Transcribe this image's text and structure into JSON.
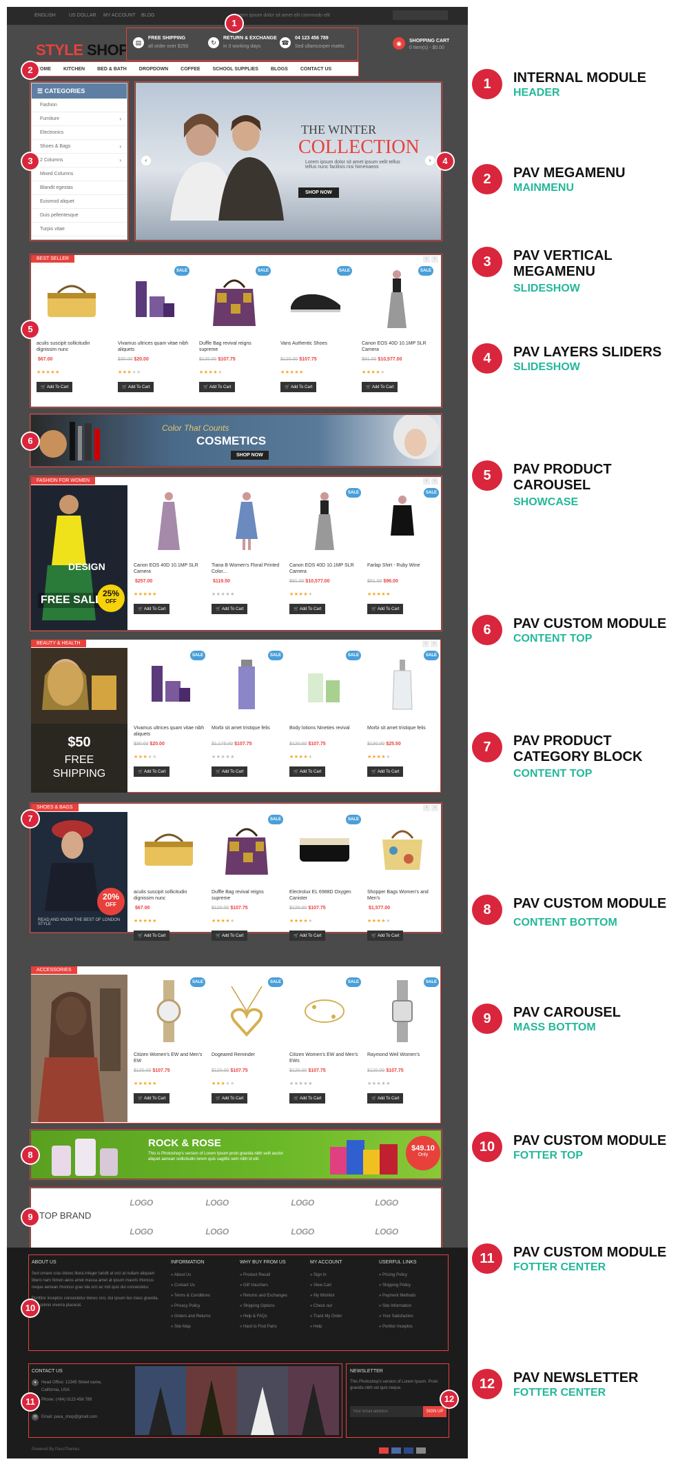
{
  "topbar": {
    "items": [
      "ENGLISH",
      "US DOLLAR",
      "MY ACCOUNT",
      "BLOG"
    ],
    "notice": "Lorem ipsum dolor sit amet elit commodo elit"
  },
  "header": {
    "logo_part1": "STYLE",
    "logo_part2": "SHOP",
    "info": [
      {
        "title": "FREE SHIPPING",
        "sub": "all order over $250",
        "icon": "truck-icon"
      },
      {
        "title": "RETURN & EXCHANGE",
        "sub": "in 3 working days",
        "icon": "refresh-icon"
      },
      {
        "title": "04 123 456 789",
        "sub": "Sed ullamcorper mattis",
        "icon": "phone-icon"
      }
    ],
    "cart_title": "SHOPPING CART",
    "cart_sub": "0 item(s) - $0.00"
  },
  "nav": [
    "HOME",
    "KITCHEN",
    "BED & BATH",
    "DROPDOWN",
    "COFFEE",
    "SCHOOL SUPPLIES",
    "BLOGS",
    "CONTACT US"
  ],
  "vmenu": {
    "title": "CATEGORIES",
    "items": [
      "Fashion",
      "Furniture",
      "Electronics",
      "Shoes & Bags",
      "2 Columns",
      "Mixed Columns",
      "Blandit egestas",
      "Euismod aliquet",
      "Duis pellentesque",
      "Turpis vitae"
    ]
  },
  "slider": {
    "title1": "THE WINTER",
    "title2": "COLLECTION",
    "sub": "Lorem ipsum dolor sit amet ipsum velit tellus tellus nunc facilisis nisi himenaeos",
    "button": "SHOP NOW"
  },
  "bestseller": {
    "tag": "BEST SELLER",
    "products": [
      {
        "name": "aculis suscipit sollicitudin dignissim nunc",
        "old": "",
        "price": "$67.00",
        "rating": 5,
        "sale": false
      },
      {
        "name": "Vivamus ultrices quam vitae nibh aliquets",
        "old": "$30.00",
        "price": "$20.00",
        "rating": 3,
        "sale": true
      },
      {
        "name": "Duffle Bag revival reigns supreme",
        "old": "$120.00",
        "price": "$107.75",
        "rating": 4,
        "sale": true
      },
      {
        "name": "Vans Authentic Shoes",
        "old": "$120.00",
        "price": "$107.75",
        "rating": 5,
        "sale": true
      },
      {
        "name": "Canon EOS 40D 10.1MP SLR Camera",
        "old": "$91.00",
        "price": "$10,577.00",
        "rating": 4,
        "sale": true
      }
    ],
    "button": "Add To Cart"
  },
  "cosmetics": {
    "line1": "Color That Counts",
    "line2": "COSMETICS",
    "button": "SHOP NOW"
  },
  "fashion": {
    "tag": "FASHION FOR WOMEN",
    "promo": {
      "line1": "DESIGN",
      "line2": "FREE SALE",
      "pct": "25%",
      "off": "OFF"
    },
    "products": [
      {
        "name": "Canon EOS 40D 10.1MP SLR Camera",
        "old": "",
        "price": "$257.00",
        "rating": 5,
        "sale": false
      },
      {
        "name": "Tiana B Women's Floral Printed Color...",
        "old": "",
        "price": "$119.50",
        "rating": 0,
        "sale": false
      },
      {
        "name": "Canon EOS 40D 10.1MP SLR Camera",
        "old": "$91.00",
        "price": "$10,577.00",
        "rating": 4,
        "sale": true
      },
      {
        "name": "Farlap Shirt - Ruby Wine",
        "old": "$51.00",
        "price": "$96.00",
        "rating": 5,
        "sale": true
      }
    ]
  },
  "beauty": {
    "tag": "BEAUTY & HEALTH",
    "promo": {
      "price": "$50",
      "line1": "FREE",
      "line2": "SHIPPING"
    },
    "products": [
      {
        "name": "Vivamus ultrices quam vitae nibh aliquets",
        "old": "$30.00",
        "price": "$20.00",
        "rating": 3,
        "sale": true
      },
      {
        "name": "Morbi sit amet tristique felis",
        "old": "$1,175.00",
        "price": "$107.75",
        "rating": 0,
        "sale": true
      },
      {
        "name": "Body lotions Nineties revival",
        "old": "$120.00",
        "price": "$107.75",
        "rating": 4,
        "sale": true
      },
      {
        "name": "Morbi sit amet tristique felis",
        "old": "$130.00",
        "price": "$25.50",
        "rating": 4,
        "sale": true
      }
    ]
  },
  "shoes": {
    "tag": "SHOES & BAGS",
    "promo": {
      "pct": "20%",
      "off": "OFF",
      "line": "READ AND KNOW THE BEST OF LONDON STYLE"
    },
    "products": [
      {
        "name": "aculis suscipit sollicitudin dignissim nunc",
        "old": "",
        "price": "$67.00",
        "rating": 5,
        "sale": false
      },
      {
        "name": "Duffle Bag revival reigns supreme",
        "old": "$120.00",
        "price": "$107.75",
        "rating": 4,
        "sale": true
      },
      {
        "name": "Electrolux EL 6988D Oxygen Canister",
        "old": "$120.00",
        "price": "$107.75",
        "rating": 4,
        "sale": true
      },
      {
        "name": "Shopper Bags Women's and Men's",
        "old": "",
        "price": "$1,577.00",
        "rating": 4,
        "sale": false
      }
    ]
  },
  "accessories": {
    "tag": "ACCESSORIES",
    "products": [
      {
        "name": "Citizen Women's EW and Men's EW",
        "old": "$120.00",
        "price": "$107.75",
        "rating": 5,
        "sale": true
      },
      {
        "name": "Dogeared Reminder",
        "old": "$120.00",
        "price": "$107.75",
        "rating": 3,
        "sale": true
      },
      {
        "name": "Citizen Women's EW and Men's EWs",
        "old": "$120.00",
        "price": "$107.75",
        "rating": 0,
        "sale": true
      },
      {
        "name": "Raymond Weil Women's",
        "old": "$120.00",
        "price": "$107.75",
        "rating": 0,
        "sale": true
      }
    ]
  },
  "rock": {
    "title": "ROCK & ROSE",
    "text": "This is Photoshop's version of Lorem Ipsum proin gravida nibh velit auctor aliquet aenean sollicitudin lorem quis sagittis sem nibh id elit.",
    "price": "$49.10",
    "only": "Only"
  },
  "brands": {
    "title": "TOP BRAND",
    "logo_text": "LOGO"
  },
  "footer": {
    "about_title": "ABOUT US",
    "about_text": "Sed ornare cras donec litora integer taridit at orci at nullam aliquam libero nam himen aeos amet massa amet at ipsum mauris rhoncus neque aenean rhoncus grav ida orci ac nisl quis dui consectetur.",
    "about_text2": "Porttitor inceptos consectetur donec orci, dui ipsum leo class gravida, felis primis viverra placerat.",
    "cols": [
      {
        "title": "INFORMATION",
        "items": [
          "About Us",
          "Contact Us",
          "Terms & Conditions",
          "Privacy Policy",
          "Orders and Returns",
          "Site Map"
        ]
      },
      {
        "title": "WHY BUY FROM US",
        "items": [
          "Product Recall",
          "Gift Vouchers",
          "Returns and Exchanges",
          "Shipping Options",
          "Help & FAQs",
          "Hard to Find Parts"
        ]
      },
      {
        "title": "MY ACCOUNT",
        "items": [
          "Sign In",
          "View Cart",
          "My Wishlist",
          "Check out",
          "Track My Order",
          "Help"
        ]
      },
      {
        "title": "USERFUL LINKS",
        "items": [
          "Pricing Policy",
          "Shipping Policy",
          "Payment Methods",
          "Site Information",
          "Your Satisfaction",
          "Portitor Inceptos"
        ]
      }
    ],
    "contact_title": "CONTACT US",
    "address1": "Head Office: 12345 Street name,",
    "address2": "California, USA",
    "phone": "Phone: (+84) 0123 456 789",
    "email": "Email: pava_shop@gmail.com",
    "newsletter_title": "NEWSLETTER",
    "newsletter_text": "This Photoshop's version of Lorem Ipsum. Proin gravida nibh vel quis neque.",
    "newsletter_placeholder": "Your email address",
    "newsletter_button": "SIGN UP",
    "powered": "Powered By PavoThemes"
  },
  "annotations": [
    {
      "num": "1",
      "title": "INTERNAL MODULE",
      "sub": "HEADER"
    },
    {
      "num": "2",
      "title": "PAV MEGAMENU",
      "sub": "MAINMENU"
    },
    {
      "num": "3",
      "title": "PAV VERTICAL MEGAMENU",
      "sub": "SLIDESHOW"
    },
    {
      "num": "4",
      "title": "PAV LAYERS SLIDERS",
      "sub": "SLIDESHOW"
    },
    {
      "num": "5",
      "title": "PAV PRODUCT CAROUSEL",
      "sub": "SHOWCASE"
    },
    {
      "num": "6",
      "title": "PAV CUSTOM MODULE",
      "sub": "CONTENT TOP"
    },
    {
      "num": "7",
      "title": "PAV PRODUCT CATEGORY BLOCK",
      "sub": "CONTENT TOP"
    },
    {
      "num": "8",
      "title": "PAV CUSTOM MODULE",
      "sub": "CONTENT BOTTOM"
    },
    {
      "num": "9",
      "title": "PAV CAROUSEL",
      "sub": "MASS BOTTOM"
    },
    {
      "num": "10",
      "title": "PAV CUSTOM MODULE",
      "sub": "FOTTER TOP"
    },
    {
      "num": "11",
      "title": "PAV CUSTOM MODULE",
      "sub": "FOTTER CENTER"
    },
    {
      "num": "12",
      "title": "PAV NEWSLETTER",
      "sub": "FOTTER CENTER"
    }
  ],
  "colors": {
    "accent": "#e8413c",
    "badge": "#d9263c",
    "subtitle": "#23b89a",
    "sale": "#4a9fd8"
  }
}
